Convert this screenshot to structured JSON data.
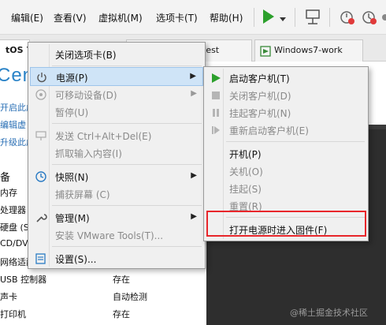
{
  "menubar": {
    "items": [
      "编辑(E)",
      "查看(V)",
      "虚拟机(M)",
      "选项卡(T)",
      "帮助(H)"
    ],
    "toolbar_icons": [
      "play-icon",
      "dropdown-arrow-icon",
      "send-ctrl-alt-del-icon",
      "snapshot-icon",
      "revert-snapshot-icon",
      "manage-snapshots-icon"
    ]
  },
  "tabs": [
    {
      "label": "tOS 7 ‹",
      "icon": "vm-icon"
    },
    {
      "label": "test",
      "icon": "vm-icon"
    },
    {
      "label": "Windows7-work",
      "icon": "vm-icon"
    }
  ],
  "vm_panel": {
    "title": "Cen",
    "links": [
      "开启此虚",
      "编辑虚",
      "升级此虚"
    ],
    "devices_heading": "备",
    "devices": [
      {
        "label": "内存",
        "value": ""
      },
      {
        "label": "处理器",
        "value": ""
      },
      {
        "label": "硬盘 (SC",
        "value": ""
      },
      {
        "label": "CD/DVD",
        "value": ""
      },
      {
        "label": "网络适配",
        "value": ""
      },
      {
        "label": "USB 控制器",
        "value": "存在"
      },
      {
        "label": "声卡",
        "value": "自动检测"
      },
      {
        "label": "打印机",
        "value": "存在"
      }
    ]
  },
  "context_menu": {
    "items": [
      {
        "label": "关闭选项卡(B)",
        "icon": "",
        "disabled": false,
        "submenu": false,
        "highlighted": false
      },
      {
        "label": "电源(P)",
        "icon": "power-icon",
        "disabled": false,
        "submenu": true,
        "highlighted": true
      },
      {
        "label": "可移动设备(D)",
        "icon": "removable-device-icon",
        "disabled": true,
        "submenu": true,
        "highlighted": false
      },
      {
        "label": "暂停(U)",
        "icon": "",
        "disabled": true,
        "submenu": false,
        "highlighted": false
      },
      {
        "label": "发送 Ctrl+Alt+Del(E)",
        "icon": "keyboard-icon",
        "disabled": true,
        "submenu": false,
        "highlighted": false
      },
      {
        "label": "抓取输入内容(I)",
        "icon": "",
        "disabled": true,
        "submenu": false,
        "highlighted": false
      },
      {
        "label": "快照(N)",
        "icon": "snapshot-icon",
        "disabled": false,
        "submenu": true,
        "highlighted": false
      },
      {
        "label": "捕获屏幕 (C)",
        "icon": "",
        "disabled": true,
        "submenu": false,
        "highlighted": false
      },
      {
        "label": "管理(M)",
        "icon": "wrench-icon",
        "disabled": false,
        "submenu": true,
        "highlighted": false
      },
      {
        "label": "安装 VMware Tools(T)...",
        "icon": "",
        "disabled": true,
        "submenu": false,
        "highlighted": false
      },
      {
        "label": "设置(S)...",
        "icon": "settings-icon",
        "disabled": false,
        "submenu": false,
        "highlighted": false
      }
    ]
  },
  "power_submenu": {
    "items": [
      {
        "label": "启动客户机(T)",
        "icon": "play-icon",
        "disabled": false
      },
      {
        "label": "关闭客户机(D)",
        "icon": "stop-icon",
        "disabled": true
      },
      {
        "label": "挂起客户机(N)",
        "icon": "pause-icon",
        "disabled": true
      },
      {
        "label": "重新启动客户机(E)",
        "icon": "restart-icon",
        "disabled": true
      },
      {
        "label": "开机(P)",
        "icon": "",
        "disabled": false
      },
      {
        "label": "关机(O)",
        "icon": "",
        "disabled": true
      },
      {
        "label": "挂起(S)",
        "icon": "",
        "disabled": true
      },
      {
        "label": "重置(R)",
        "icon": "",
        "disabled": true
      },
      {
        "label": "打开电源时进入固件(F)",
        "icon": "",
        "disabled": false
      }
    ],
    "highlight_color": "#e8262b"
  },
  "watermark": "@稀土掘金技术社区"
}
